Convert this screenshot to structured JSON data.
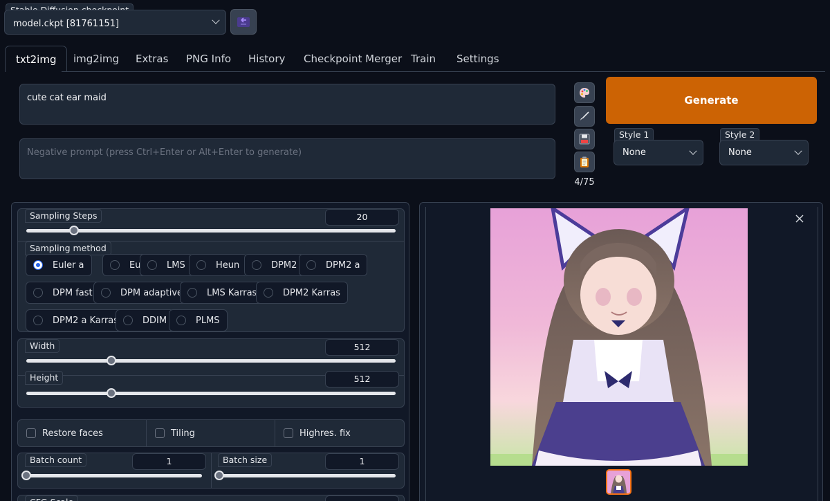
{
  "checkpoint": {
    "label": "Stable Diffusion checkpoint",
    "value": "model.ckpt [81761151]"
  },
  "refresh_button": {
    "icon": "refresh-icon"
  },
  "tabs": [
    {
      "label": "txt2img",
      "active": true
    },
    {
      "label": "img2img"
    },
    {
      "label": "Extras"
    },
    {
      "label": "PNG Info"
    },
    {
      "label": "History"
    },
    {
      "label": "Checkpoint Merger"
    },
    {
      "label": "Train"
    },
    {
      "label": "Settings"
    }
  ],
  "prompt": {
    "value": "cute cat ear maid"
  },
  "negative_prompt": {
    "placeholder": "Negative prompt (press Ctrl+Enter or Alt+Enter to generate)"
  },
  "tools": {
    "icons": [
      "palette-icon",
      "brush-icon",
      "save-icon",
      "clipboard-icon"
    ],
    "token_count": "4/75"
  },
  "generate": {
    "label": "Generate",
    "color": "#cc6304"
  },
  "style1": {
    "label": "Style 1",
    "value": "None"
  },
  "style2": {
    "label": "Style 2",
    "value": "None"
  },
  "sampling_steps": {
    "label": "Sampling Steps",
    "value": "20",
    "min": 1,
    "max": 150,
    "fraction": 0.13
  },
  "sampling_method": {
    "label": "Sampling method",
    "selected": "Euler a",
    "options": [
      "Euler a",
      "Euler",
      "LMS",
      "Heun",
      "DPM2",
      "DPM2 a",
      "DPM fast",
      "DPM adaptive",
      "LMS Karras",
      "DPM2 Karras",
      "DPM2 a Karras",
      "DDIM",
      "PLMS"
    ]
  },
  "width": {
    "label": "Width",
    "value": "512",
    "fraction": 0.23
  },
  "height": {
    "label": "Height",
    "value": "512",
    "fraction": 0.23
  },
  "checkboxes": [
    "Restore faces",
    "Tiling",
    "Highres. fix"
  ],
  "batch_count": {
    "label": "Batch count",
    "value": "1",
    "fraction": 0
  },
  "batch_size": {
    "label": "Batch size",
    "value": "1",
    "fraction": 0
  },
  "cfg_scale": {
    "label": "CFG Scale"
  },
  "gallery": {
    "close_icon": "close-icon",
    "image_alt": "generated-image"
  },
  "accent_color": "#2563eb"
}
